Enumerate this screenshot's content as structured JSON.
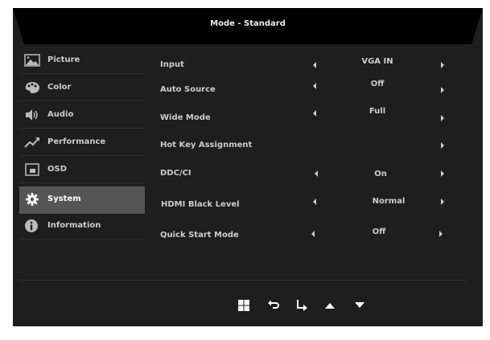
{
  "header": {
    "title": "Mode - Standard"
  },
  "sidebar": {
    "items": [
      {
        "label": "Picture",
        "icon": "picture-icon"
      },
      {
        "label": "Color",
        "icon": "palette-icon"
      },
      {
        "label": "Audio",
        "icon": "speaker-icon"
      },
      {
        "label": "Performance",
        "icon": "trend-icon"
      },
      {
        "label": "OSD",
        "icon": "osd-icon"
      },
      {
        "label": "System",
        "icon": "gear-icon",
        "selected": true
      },
      {
        "label": "Information",
        "icon": "info-icon"
      }
    ]
  },
  "settings": [
    {
      "label": "Input",
      "value": "VGA IN"
    },
    {
      "label": "Auto Source",
      "value": "Off"
    },
    {
      "label": "Wide Mode",
      "value": "Full"
    },
    {
      "label": "Hot Key Assignment",
      "value": ""
    },
    {
      "label": "DDC/CI",
      "value": "On"
    },
    {
      "label": "HDMI Black Level",
      "value": "Normal"
    },
    {
      "label": "Quick Start Mode",
      "value": "Off"
    }
  ],
  "buttons": [
    "menu-icon",
    "back-icon",
    "enter-icon",
    "up-icon",
    "down-icon"
  ]
}
